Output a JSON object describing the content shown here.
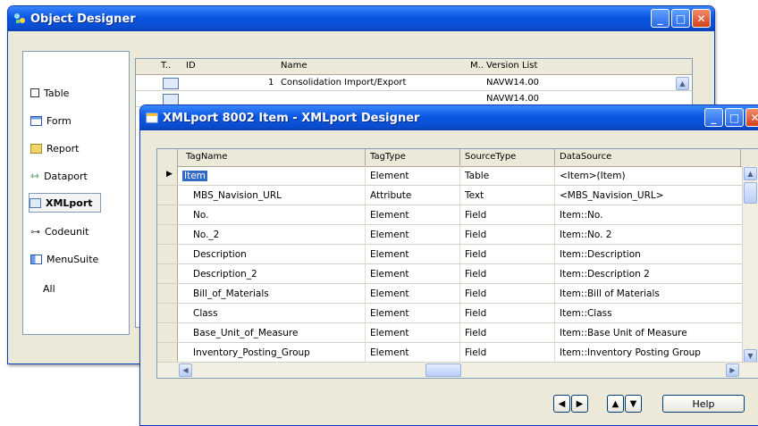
{
  "object_designer": {
    "title": "Object Designer",
    "sidebar": [
      {
        "label": "Table",
        "icon": "table-icon"
      },
      {
        "label": "Form",
        "icon": "form-icon"
      },
      {
        "label": "Report",
        "icon": "report-icon"
      },
      {
        "label": "Dataport",
        "icon": "dataport-icon"
      },
      {
        "label": "XMLport",
        "icon": "xmlport-icon",
        "selected": true
      },
      {
        "label": "Codeunit",
        "icon": "codeunit-icon"
      },
      {
        "label": "MenuSuite",
        "icon": "menusuite-icon"
      },
      {
        "label": "All",
        "icon": ""
      }
    ],
    "columns": [
      "T..",
      "ID",
      "Name",
      "M..",
      "Version List"
    ],
    "rows": [
      {
        "id": "1",
        "name": "Consolidation Import/Export",
        "version": "NAVW14.00"
      },
      {
        "id": "",
        "name": "",
        "version": "NAVW14.00"
      }
    ]
  },
  "xmlport_designer": {
    "title": "XMLport 8002 Item - XMLport Designer",
    "columns": [
      "TagName",
      "TagType",
      "SourceType",
      "DataSource"
    ],
    "rows": [
      {
        "tag": "Item",
        "type": "Element",
        "source": "Table",
        "data": "<Item>(Item)",
        "current": true
      },
      {
        "tag": "MBS_Navision_URL",
        "type": "Attribute",
        "source": "Text",
        "data": "<MBS_Navision_URL>"
      },
      {
        "tag": "No.",
        "type": "Element",
        "source": "Field",
        "data": "Item::No."
      },
      {
        "tag": "No._2",
        "type": "Element",
        "source": "Field",
        "data": "Item::No. 2"
      },
      {
        "tag": "Description",
        "type": "Element",
        "source": "Field",
        "data": "Item::Description"
      },
      {
        "tag": "Description_2",
        "type": "Element",
        "source": "Field",
        "data": "Item::Description 2"
      },
      {
        "tag": "Bill_of_Materials",
        "type": "Element",
        "source": "Field",
        "data": "Item::Bill of Materials"
      },
      {
        "tag": "Class",
        "type": "Element",
        "source": "Field",
        "data": "Item::Class"
      },
      {
        "tag": "Base_Unit_of_Measure",
        "type": "Element",
        "source": "Field",
        "data": "Item::Base Unit of Measure"
      },
      {
        "tag": "Inventory_Posting_Group",
        "type": "Element",
        "source": "Field",
        "data": "Item::Inventory Posting Group"
      }
    ],
    "help_label": "Help"
  },
  "colors": {
    "titlebar": "#0a56e0",
    "selection": "#316ac5",
    "window_bg": "#ece9d8"
  }
}
